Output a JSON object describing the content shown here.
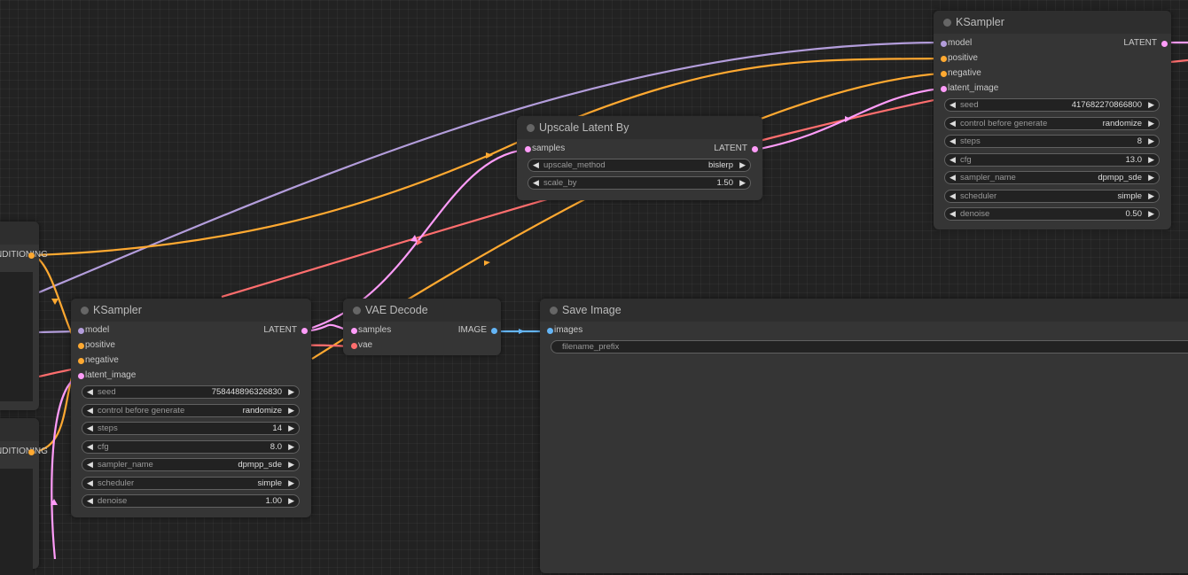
{
  "colors": {
    "background": "#222222",
    "node_body": "#353535",
    "node_title": "#2e2e2e",
    "model": "#b39ddb",
    "conditioning": "#ffa931",
    "latent": "#ff9cf9",
    "vae": "#ff6e6e",
    "image": "#64b5f6"
  },
  "left_nodes": {
    "top_output_label": "CONDITIONING",
    "bottom_output_label": "CONDITIONING"
  },
  "ksampler_top": {
    "title": "KSampler",
    "inputs": [
      "model",
      "positive",
      "negative",
      "latent_image"
    ],
    "output": "LATENT",
    "widgets": [
      {
        "label": "seed",
        "value": "417682270866800"
      },
      {
        "label": "control before generate",
        "value": "randomize"
      },
      {
        "label": "steps",
        "value": "8"
      },
      {
        "label": "cfg",
        "value": "13.0"
      },
      {
        "label": "sampler_name",
        "value": "dpmpp_sde"
      },
      {
        "label": "scheduler",
        "value": "simple"
      },
      {
        "label": "denoise",
        "value": "0.50"
      }
    ]
  },
  "upscale": {
    "title": "Upscale Latent By",
    "input": "samples",
    "output": "LATENT",
    "widgets": [
      {
        "label": "upscale_method",
        "value": "bislerp"
      },
      {
        "label": "scale_by",
        "value": "1.50"
      }
    ]
  },
  "ksampler_bottom": {
    "title": "KSampler",
    "inputs": [
      "model",
      "positive",
      "negative",
      "latent_image"
    ],
    "output": "LATENT",
    "widgets": [
      {
        "label": "seed",
        "value": "758448896326830"
      },
      {
        "label": "control before generate",
        "value": "randomize"
      },
      {
        "label": "steps",
        "value": "14"
      },
      {
        "label": "cfg",
        "value": "8.0"
      },
      {
        "label": "sampler_name",
        "value": "dpmpp_sde"
      },
      {
        "label": "scheduler",
        "value": "simple"
      },
      {
        "label": "denoise",
        "value": "1.00"
      }
    ]
  },
  "vae_decode": {
    "title": "VAE Decode",
    "inputs": [
      "samples",
      "vae"
    ],
    "output": "IMAGE"
  },
  "save_image": {
    "title": "Save Image",
    "input": "images",
    "widget_label": "filename_prefix"
  },
  "icons": {
    "widget_left": "◀",
    "widget_right": "▶",
    "title_dot": "node-collapse-dot"
  }
}
